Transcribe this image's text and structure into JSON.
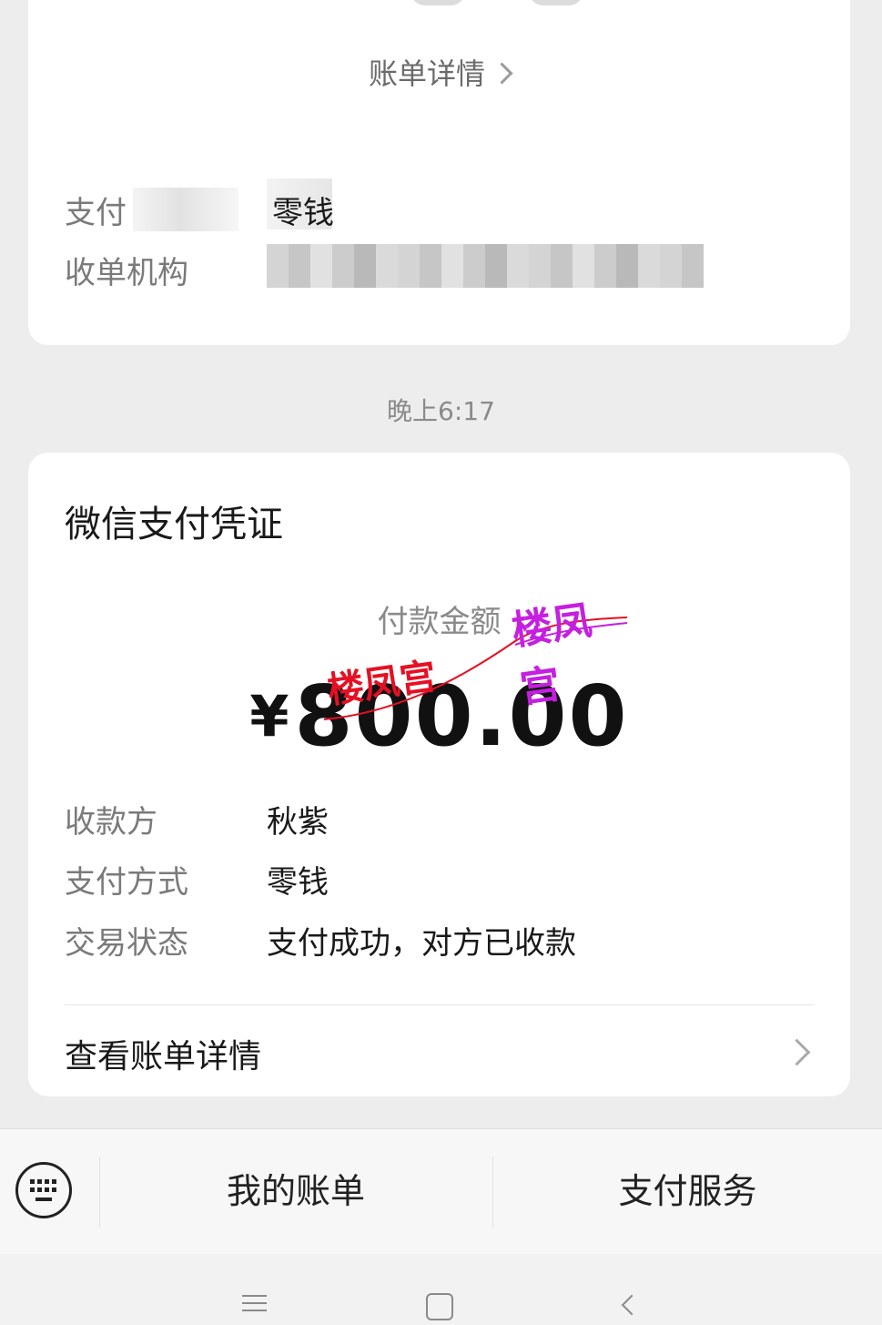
{
  "previous_card": {
    "bill_detail_link": "账单详情",
    "rows": [
      {
        "label": "支付",
        "value": "零钱"
      },
      {
        "label": "收单机构",
        "value": ""
      }
    ]
  },
  "timestamp": "晚上6:17",
  "voucher": {
    "title": "微信支付凭证",
    "amount_label": "付款金额",
    "currency_symbol": "¥",
    "amount": "800.00",
    "watermark_texts": [
      "楼凤宫",
      "楼凤宫"
    ],
    "watermark_colors": [
      "#c51fe0",
      "#e51023"
    ],
    "rows": [
      {
        "label": "收款方",
        "value": "秋紫"
      },
      {
        "label": "支付方式",
        "value": "零钱"
      },
      {
        "label": "交易状态",
        "value": "支付成功，对方已收款"
      }
    ],
    "view_bill_label": "查看账单详情"
  },
  "bottom_bar": {
    "keyboard_icon": "keyboard-icon",
    "my_bills": "我的账单",
    "pay_services": "支付服务"
  },
  "system_nav": {
    "menu_icon": "menu-icon",
    "home_icon": "home-icon",
    "back_icon": "back-icon"
  }
}
